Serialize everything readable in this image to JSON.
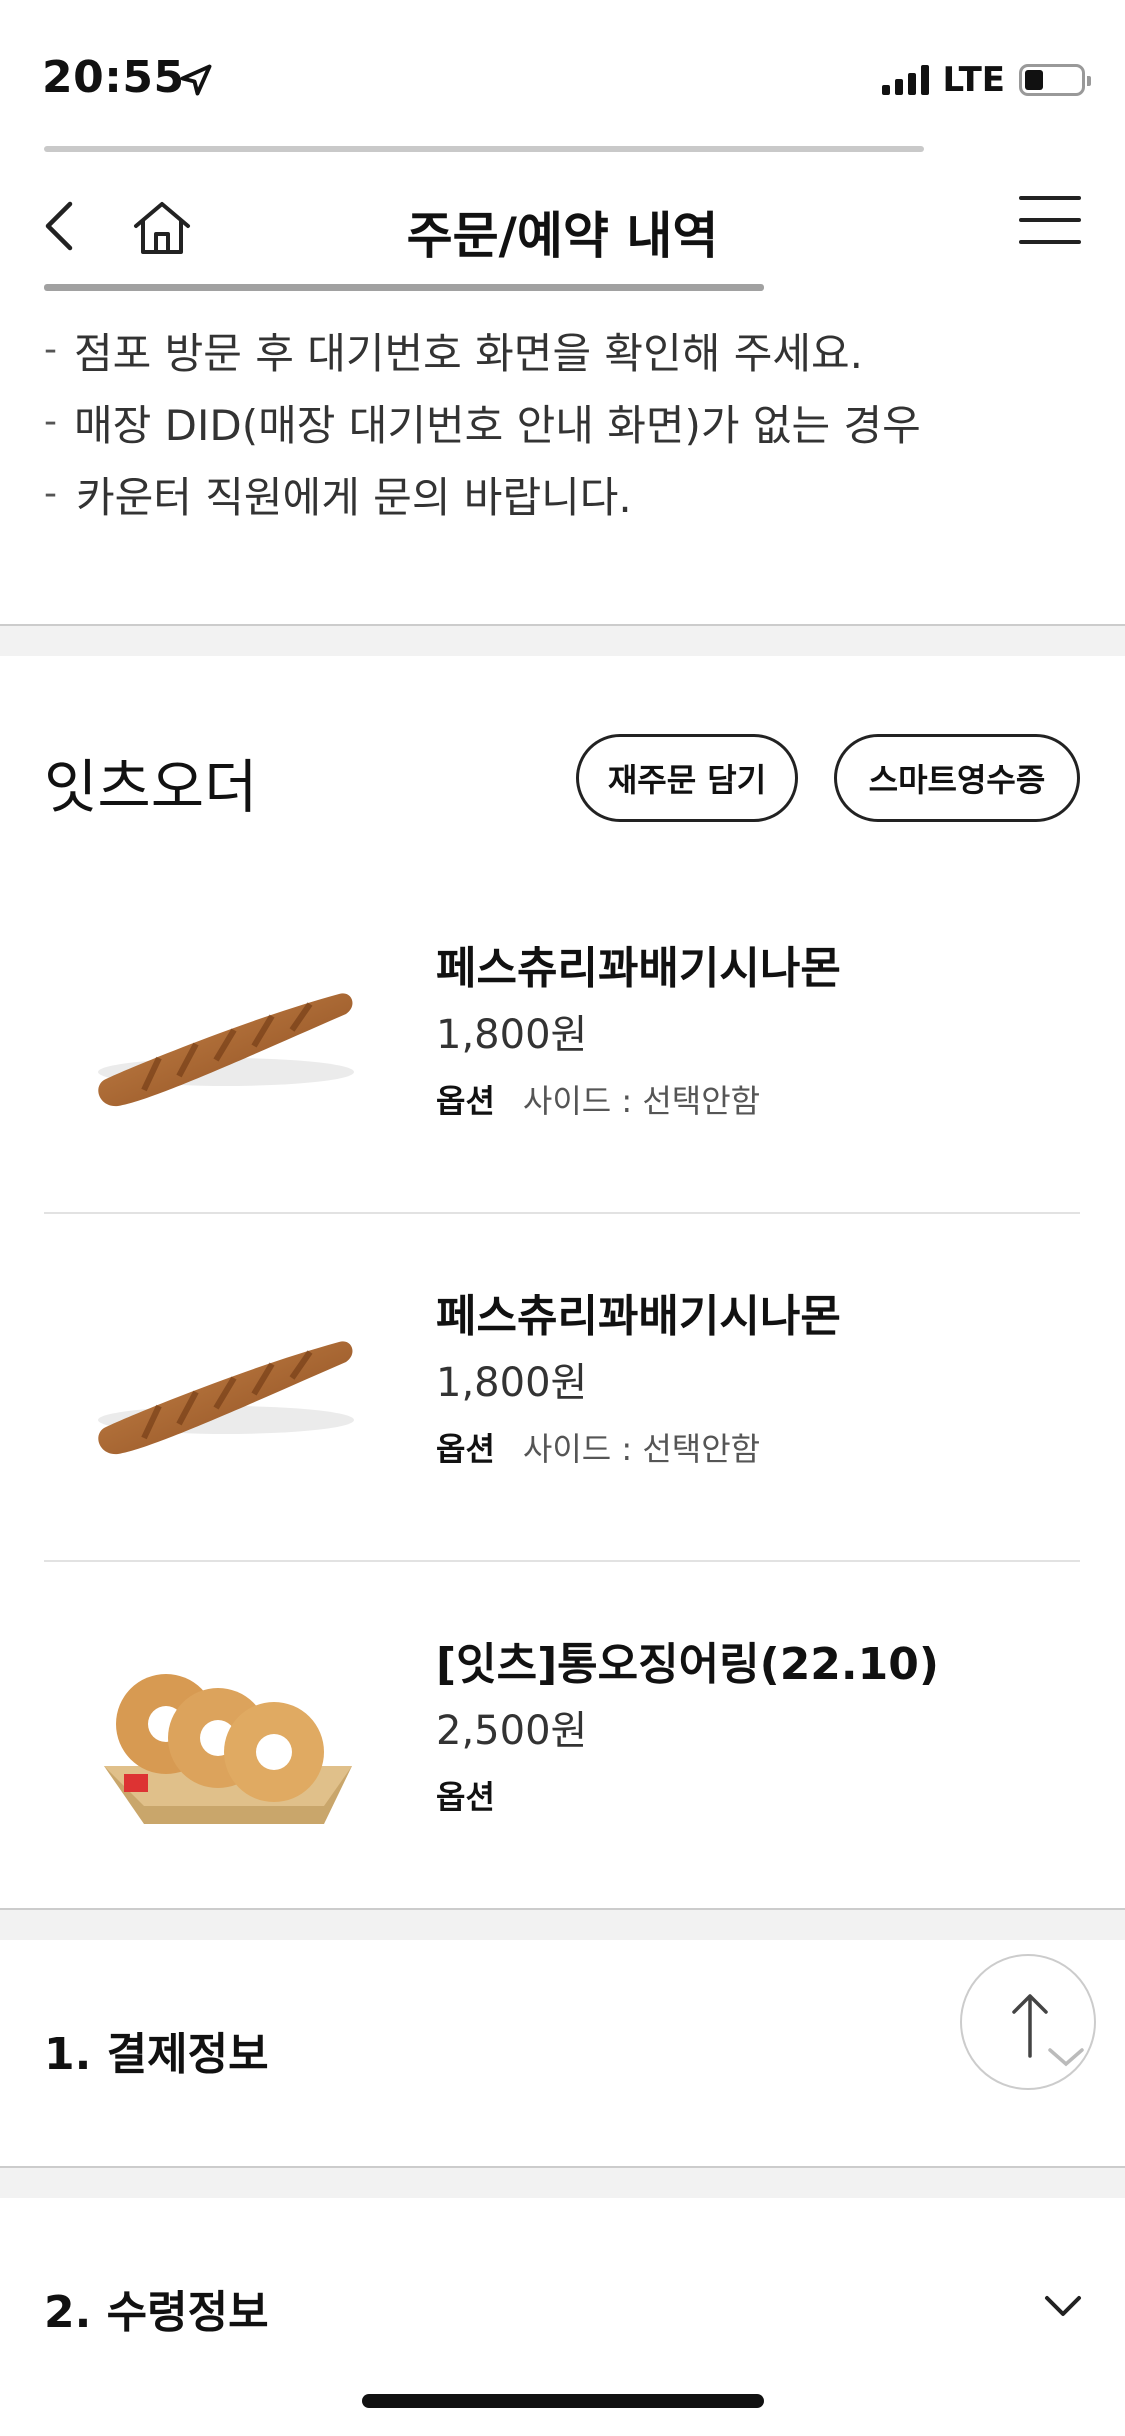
{
  "status": {
    "time": "20:55",
    "network": "LTE"
  },
  "header": {
    "title": "주문/예약 내역"
  },
  "notice": {
    "items": [
      "점포 방문 후 대기번호 화면을 확인해 주세요.",
      "매장 DID(매장 대기번호 안내 화면)가 없는 경우",
      "카운터 직원에게 문의 바랍니다."
    ]
  },
  "order": {
    "title": "잇츠오더",
    "reorder_label": "재주문 담기",
    "receipt_label": "스마트영수증",
    "option_label": "옵션",
    "items": [
      {
        "name": "페스츄리꽈배기시나몬",
        "price": "1,800원",
        "option": "사이드 : 선택안함"
      },
      {
        "name": "페스츄리꽈배기시나몬",
        "price": "1,800원",
        "option": "사이드 : 선택안함"
      },
      {
        "name": "[잇츠]통오징어링(22.10)",
        "price": "2,500원",
        "option": ""
      }
    ]
  },
  "sections": {
    "payment": "1. 결제정보",
    "pickup": "2. 수령정보"
  },
  "colors": {
    "accent": "#111111",
    "divider": "#f2f2f2"
  }
}
